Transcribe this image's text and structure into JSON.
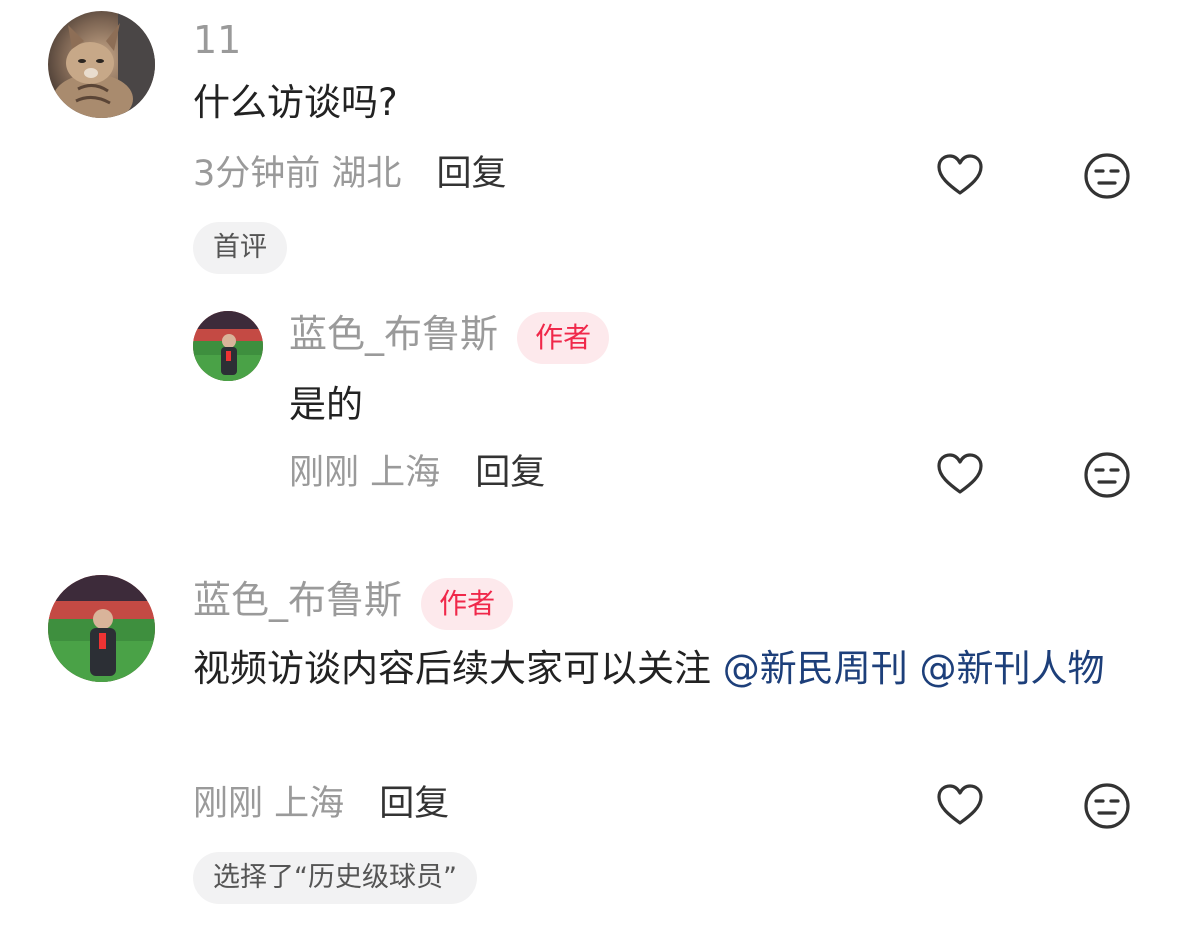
{
  "comments": [
    {
      "username": "11",
      "content": "什么访谈吗?",
      "time": "3分钟前",
      "location": "湖北",
      "reply_label": "回复",
      "tag": "首评",
      "reply": {
        "username": "蓝色_布鲁斯",
        "badge": "作者",
        "content": "是的",
        "time": "刚刚",
        "location": "上海",
        "reply_label": "回复"
      }
    },
    {
      "username": "蓝色_布鲁斯",
      "badge": "作者",
      "content_text": "视频访谈内容后续大家可以关注",
      "mentions": [
        "@新民周刊",
        "@新刊人物"
      ],
      "time": "刚刚",
      "location": "上海",
      "reply_label": "回复",
      "tag": "选择了“历史级球员”"
    }
  ],
  "icons": {
    "like": "heart-outline-icon",
    "dislike": "meh-face-icon"
  },
  "colors": {
    "author_badge_bg": "#fde9ec",
    "author_badge_text": "#f0284a",
    "mention": "#1d3f7a",
    "meta_gray": "#9a9a9a"
  }
}
